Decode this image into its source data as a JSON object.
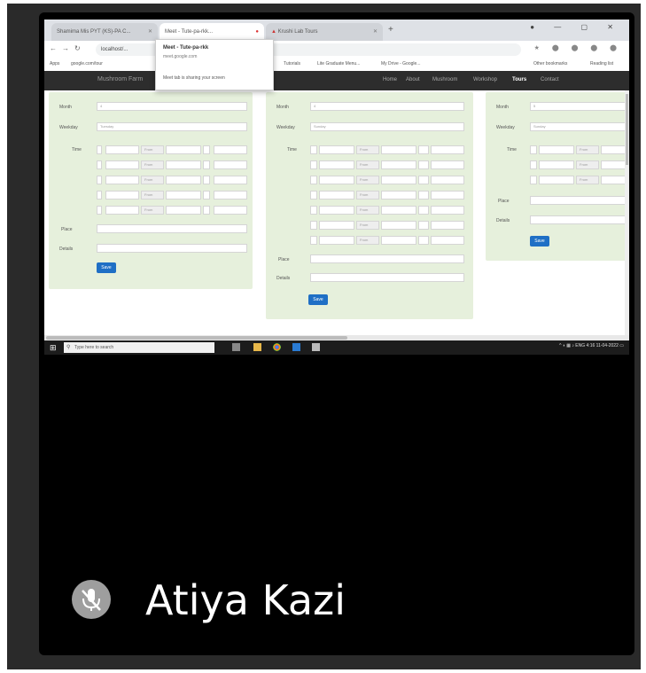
{
  "browser": {
    "tabs": [
      "Shamima Mis PYT (KS)-PA C...",
      "Meet - Tute-pa-rkk...",
      "Krushi Lab Tours"
    ],
    "popup": {
      "title": "Meet - Tute-pa-rkk",
      "subtitle": "meet.google.com",
      "action": "Meet tab is sharing your screen"
    },
    "address": "localhost/...",
    "bookmarks": [
      "Apps",
      "google.com/tour",
      "Tutorials",
      "Lite Graduate Menu...",
      "My Drive - Google...",
      "Other bookmarks",
      "Reading list"
    ]
  },
  "site": {
    "brand": "Mushroom Farm",
    "nav": [
      "Home",
      "About",
      "Mushroom",
      "Workshop",
      "Tours",
      "Contact"
    ],
    "active_nav": "Tours"
  },
  "forms": {
    "labels": {
      "month": "Month",
      "weekday": "Weekday",
      "time": "Time",
      "place": "Place",
      "details": "Details",
      "from": "From",
      "save": "Save"
    },
    "form1": {
      "month": "4",
      "weekday": "Tuesday"
    },
    "form2": {
      "month": "4",
      "weekday": "Sunday"
    },
    "form3": {
      "month": "5",
      "weekday": "Sunday"
    }
  },
  "taskbar": {
    "search_placeholder": "Type here to search",
    "clock_time": "4:16",
    "clock_date": "11-04-2022"
  },
  "participant": {
    "name": "Atiya Kazi",
    "mic_state": "muted"
  },
  "colors": {
    "panel": "#e6f0dc",
    "button": "#1f6fc5",
    "nav_bg": "#2d2d2d"
  }
}
